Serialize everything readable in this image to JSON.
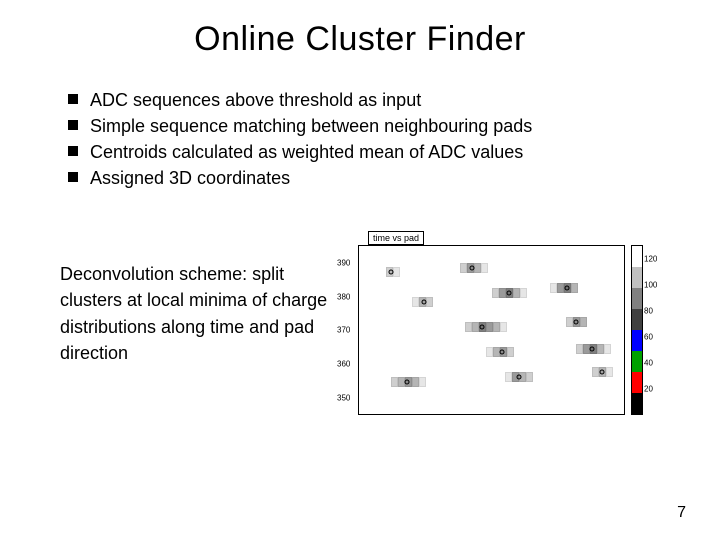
{
  "title": "Online Cluster Finder",
  "bullets": [
    "ADC sequences above threshold as input",
    "Simple sequence matching between neighbouring pads",
    "Centroids calculated as weighted mean of ADC values",
    "Assigned 3D coordinates"
  ],
  "deconv_text": "Deconvolution scheme: split clusters at local minima of charge distributions along time and pad direction",
  "page_number": "7",
  "chart_data": {
    "type": "scatter",
    "title": "time vs pad",
    "ylabel": "",
    "xlabel": "",
    "ylim": [
      345,
      395
    ],
    "yticks": [
      350,
      360,
      370,
      380,
      390
    ],
    "colorbar": {
      "ticks": [
        20,
        40,
        60,
        80,
        100,
        120
      ],
      "colors": [
        "#ffffff",
        "#c0c0c0",
        "#808080",
        "#404040",
        "#0000ff",
        "#00a000",
        "#ff0000",
        "#000000"
      ]
    },
    "clusters": [
      {
        "y_pct": 12,
        "x_pct": 10,
        "len": 2,
        "shades": [
          1,
          0
        ],
        "centroid": 0.4
      },
      {
        "y_pct": 10,
        "x_pct": 38,
        "len": 4,
        "shades": [
          1,
          3,
          2,
          0
        ],
        "centroid": 0.45
      },
      {
        "y_pct": 30,
        "x_pct": 20,
        "len": 3,
        "shades": [
          0,
          2,
          1
        ],
        "centroid": 0.55
      },
      {
        "y_pct": 25,
        "x_pct": 50,
        "len": 5,
        "shades": [
          1,
          3,
          4,
          2,
          0
        ],
        "centroid": 0.5
      },
      {
        "y_pct": 22,
        "x_pct": 72,
        "len": 4,
        "shades": [
          0,
          3,
          4,
          2
        ],
        "centroid": 0.6
      },
      {
        "y_pct": 45,
        "x_pct": 40,
        "len": 6,
        "shades": [
          1,
          2,
          4,
          3,
          2,
          0
        ],
        "centroid": 0.4
      },
      {
        "y_pct": 42,
        "x_pct": 78,
        "len": 3,
        "shades": [
          1,
          3,
          2
        ],
        "centroid": 0.5
      },
      {
        "y_pct": 60,
        "x_pct": 48,
        "len": 4,
        "shades": [
          0,
          2,
          3,
          1
        ],
        "centroid": 0.55
      },
      {
        "y_pct": 58,
        "x_pct": 82,
        "len": 5,
        "shades": [
          1,
          3,
          4,
          2,
          0
        ],
        "centroid": 0.45
      },
      {
        "y_pct": 78,
        "x_pct": 12,
        "len": 5,
        "shades": [
          1,
          2,
          3,
          2,
          0
        ],
        "centroid": 0.45
      },
      {
        "y_pct": 75,
        "x_pct": 55,
        "len": 4,
        "shades": [
          0,
          3,
          2,
          1
        ],
        "centroid": 0.5
      },
      {
        "y_pct": 72,
        "x_pct": 88,
        "len": 3,
        "shades": [
          1,
          2,
          0
        ],
        "centroid": 0.45
      }
    ]
  }
}
